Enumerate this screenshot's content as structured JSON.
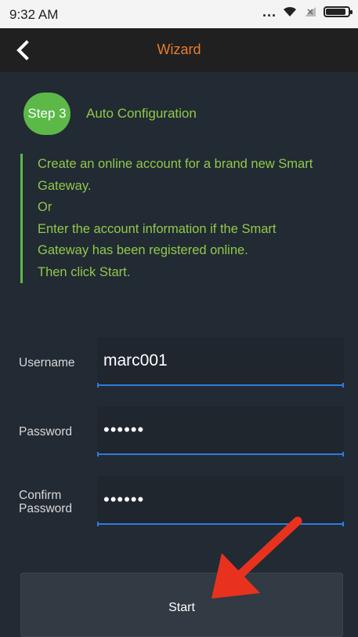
{
  "status_bar": {
    "time": "9:32 AM",
    "dots": "...",
    "battery_level": 0.9
  },
  "nav": {
    "title": "Wizard",
    "back_icon": "chevron-left-icon",
    "title_color": "#e67c2c"
  },
  "step": {
    "badge": "Step 3",
    "title": "Auto Configuration",
    "badge_color": "#5cb948"
  },
  "instructions": [
    "Create an online account for a brand new Smart",
    "Gateway.",
    "Or",
    "Enter the account information if the Smart",
    "Gateway has been registered online.",
    "Then click Start."
  ],
  "form": {
    "username": {
      "label": "Username",
      "value": "marc001"
    },
    "password": {
      "label": "Password",
      "value": "••••••"
    },
    "confirm": {
      "label_line1": "Confirm",
      "label_line2": "Password",
      "value": "••••••"
    }
  },
  "start_button": {
    "label": "Start"
  },
  "colors": {
    "background": "#222a33",
    "accent_green": "#8fc94a",
    "input_underline": "#2f7be0",
    "annotation_arrow": "#e8321e"
  }
}
